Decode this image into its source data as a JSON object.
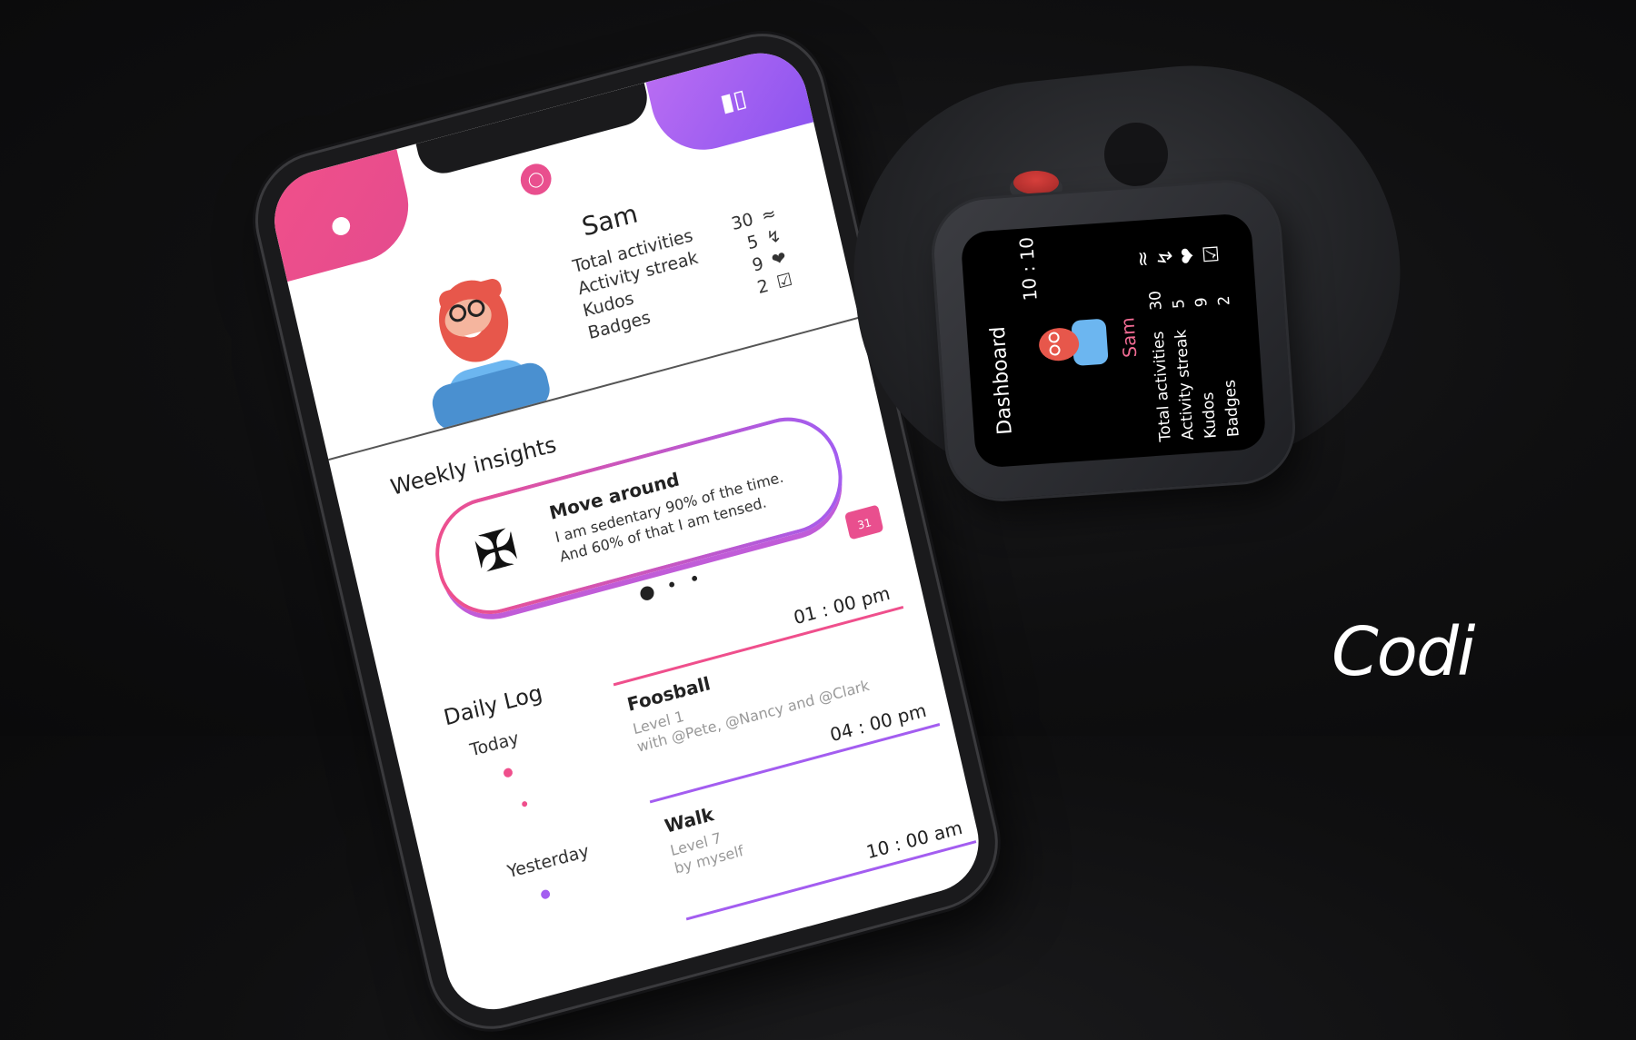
{
  "phone": {
    "profile": {
      "name": "Sam",
      "stats": [
        {
          "label": "Total activities",
          "value": "30",
          "icon": "zigzag-icon"
        },
        {
          "label": "Activity streak",
          "value": "5",
          "icon": "lightning-icon"
        },
        {
          "label": "Kudos",
          "value": "9",
          "icon": "heart-hand-icon"
        },
        {
          "label": "Badges",
          "value": "2",
          "icon": "trophy-icon"
        }
      ]
    },
    "insights": {
      "title": "Weekly insights",
      "card_title": "Move around",
      "line1": "I am sedentary 90% of the time.",
      "line2": "And 60% of that I am tensed.",
      "calendar_day": "31"
    },
    "daily_log": {
      "title": "Daily Log",
      "entries": [
        {
          "time": "01 : 00 pm",
          "day": "Today",
          "title": "Foosball",
          "level": "Level 1",
          "with": "with @Pete, @Nancy and @Clark"
        },
        {
          "time": "04 : 00 pm",
          "day": "Yesterday",
          "title": "Walk",
          "level": "Level 7",
          "with": "by myself"
        },
        {
          "time": "10 : 00 am"
        }
      ]
    },
    "colors": {
      "pink": "#ef4f8c",
      "purple": "#a35df0"
    }
  },
  "watch": {
    "title": "Dashboard",
    "time": "10 : 10",
    "name": "Sam",
    "stats": [
      {
        "label": "Total activities",
        "value": "30"
      },
      {
        "label": "Activity streak",
        "value": "5"
      },
      {
        "label": "Kudos",
        "value": "9"
      },
      {
        "label": "Badges",
        "value": "2"
      }
    ]
  },
  "brand": {
    "name": "Codi"
  }
}
